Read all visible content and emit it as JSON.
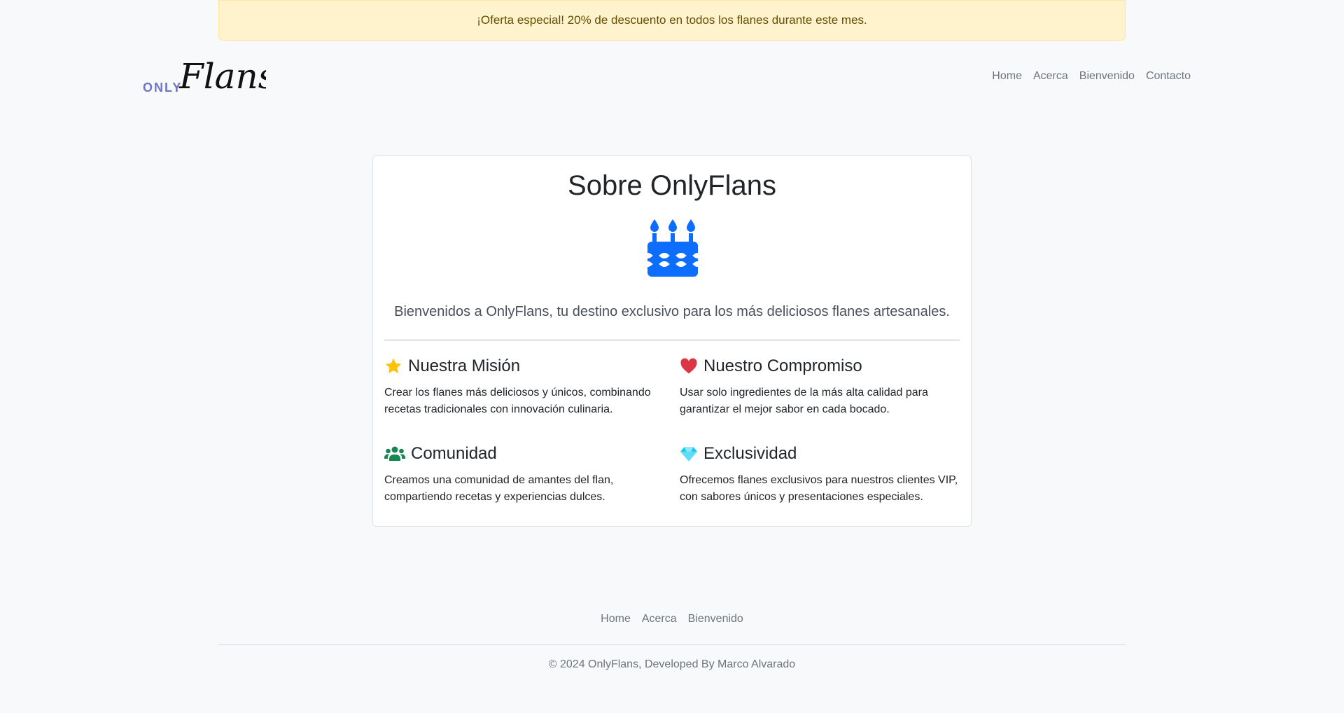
{
  "promo": {
    "text": "¡Oferta especial! 20% de descuento en todos los flanes durante este mes."
  },
  "brand": {
    "prefix": "ONLY",
    "name": "Flans",
    "prefix_color": "#6f74c9"
  },
  "nav": {
    "items": [
      "Home",
      "Acerca",
      "Bienvenido",
      "Contacto"
    ]
  },
  "card": {
    "title": "Sobre OnlyFlans",
    "icon": "cake-icon",
    "icon_color": "#0d6efd",
    "lead": "Bienvenidos a OnlyFlans, tu destino exclusivo para los más deliciosos flanes artesanales.",
    "features": [
      {
        "icon": "star-icon",
        "icon_color": "#ffc107",
        "title": "Nuestra Misión",
        "text": "Crear los flanes más deliciosos y únicos, combinando recetas tradicionales con innovación culinaria."
      },
      {
        "icon": "heart-icon",
        "icon_color": "#dc3545",
        "title": "Nuestro Compromiso",
        "text": "Usar solo ingredientes de la más alta calidad para garantizar el mejor sabor en cada bocado."
      },
      {
        "icon": "people-icon",
        "icon_color": "#198754",
        "title": "Comunidad",
        "text": "Creamos una comunidad de amantes del flan, compartiendo recetas y experiencias dulces."
      },
      {
        "icon": "gem-icon",
        "icon_color": "#0dcaf0",
        "title": "Exclusividad",
        "text": "Ofrecemos flanes exclusivos para nuestros clientes VIP, con sabores únicos y presentaciones especiales."
      }
    ]
  },
  "footer": {
    "links": [
      "Home",
      "Acerca",
      "Bienvenido"
    ],
    "copyright": "© 2024 OnlyFlans, Developed By Marco Alvarado"
  }
}
